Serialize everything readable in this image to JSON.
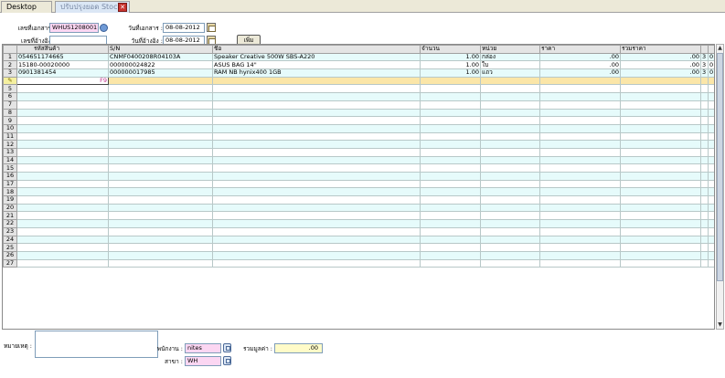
{
  "tabs": [
    {
      "label": "Desktop"
    },
    {
      "label": "ปรับปรุงยอด Stock"
    }
  ],
  "header": {
    "doc_no_label": "เลขที่เอกสาร :",
    "doc_no_value": "WHUS1208001",
    "ref_no_label": "เลขที่อ้างอิง :",
    "ref_no_value": "",
    "doc_date_label": "วันที่เอกสาร :",
    "doc_date_value": "08-08-2012",
    "ref_date_label": "วันที่อ้างอิง :",
    "ref_date_value": "08-08-2012",
    "add_button": "เพิ่ม"
  },
  "grid": {
    "columns": [
      "รหัสสินค้า",
      "S/N",
      "ชื่อ",
      "จำนวน",
      "หน่วย",
      "ราคา",
      "รวมราคา",
      "",
      ""
    ],
    "rows": [
      {
        "no": "1",
        "code": "054651174665",
        "sn": "CNMF0400208R04103A",
        "name": "Speaker Creative 500W SBS-A220",
        "qty": "1.00",
        "unit": "กล่อง",
        "price": ".00",
        "total": ".00",
        "c8": "3",
        "c9": "0"
      },
      {
        "no": "2",
        "code": "15180-00020000",
        "sn": "000000024822",
        "name": "ASUS BAG 14\"",
        "qty": "1.00",
        "unit": "ใบ",
        "price": ".00",
        "total": ".00",
        "c8": "3",
        "c9": "0"
      },
      {
        "no": "3",
        "code": "0901381454",
        "sn": "000000017985",
        "name": "RAM NB hynix400 1GB",
        "qty": "1.00",
        "unit": "แถว",
        "price": ".00",
        "total": ".00",
        "c8": "3",
        "c9": "0"
      }
    ],
    "edit_hint": "F9",
    "row_numbers": [
      "5",
      "6",
      "7",
      "8",
      "9",
      "10",
      "11",
      "12",
      "13",
      "14",
      "15",
      "16",
      "17",
      "18",
      "19",
      "20",
      "21",
      "22",
      "23",
      "24",
      "25",
      "26",
      "27"
    ]
  },
  "footer": {
    "note_label": "หมายเหตุ :",
    "employee_label": "พนักงาน :",
    "employee_value": "nites",
    "branch_label": "สาขา :",
    "branch_value": "WH",
    "total_label": "รวมมูลค่า :",
    "total_value": ".00"
  }
}
